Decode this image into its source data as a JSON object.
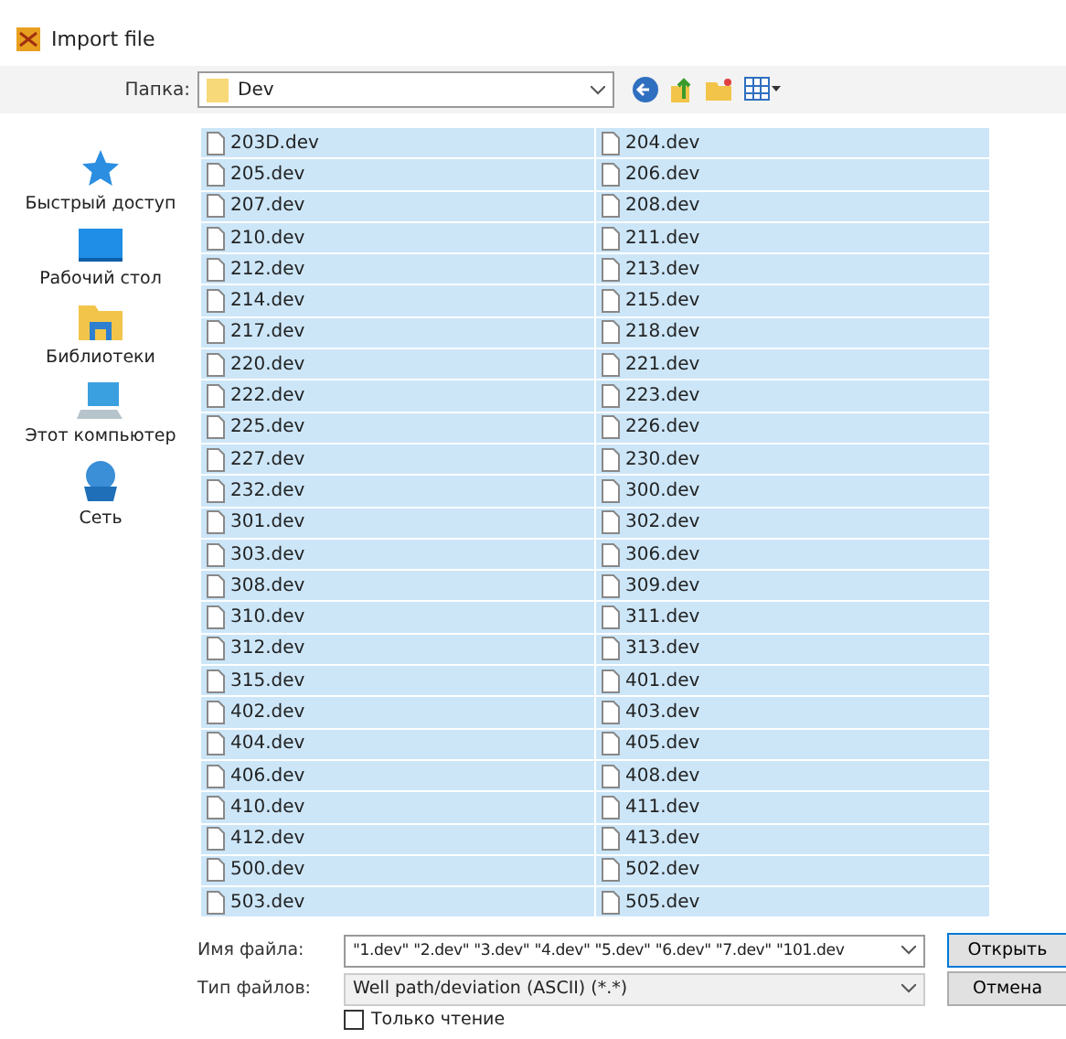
{
  "window": {
    "title": "Import file"
  },
  "look_in": {
    "label": "Папка:",
    "value": "Dev"
  },
  "places": [
    {
      "label": "Быстрый доступ",
      "kind": "star"
    },
    {
      "label": "Рабочий стол",
      "kind": "desktop"
    },
    {
      "label": "Библиотеки",
      "kind": "library"
    },
    {
      "label": "Этот компьютер",
      "kind": "computer"
    },
    {
      "label": "Сеть",
      "kind": "network"
    }
  ],
  "files": [
    {
      "name": "203D.dev",
      "selected": true
    },
    {
      "name": "204.dev",
      "selected": true
    },
    {
      "name": "205.dev",
      "selected": true
    },
    {
      "name": "206.dev",
      "selected": true
    },
    {
      "name": "207.dev",
      "selected": true
    },
    {
      "name": "208.dev",
      "selected": true
    },
    {
      "name": "210.dev",
      "selected": true
    },
    {
      "name": "211.dev",
      "selected": true
    },
    {
      "name": "212.dev",
      "selected": true
    },
    {
      "name": "213.dev",
      "selected": true
    },
    {
      "name": "214.dev",
      "selected": true
    },
    {
      "name": "215.dev",
      "selected": true
    },
    {
      "name": "217.dev",
      "selected": true
    },
    {
      "name": "218.dev",
      "selected": true
    },
    {
      "name": "220.dev",
      "selected": true
    },
    {
      "name": "221.dev",
      "selected": true
    },
    {
      "name": "222.dev",
      "selected": true
    },
    {
      "name": "223.dev",
      "selected": true
    },
    {
      "name": "225.dev",
      "selected": true
    },
    {
      "name": "226.dev",
      "selected": true
    },
    {
      "name": "227.dev",
      "selected": true
    },
    {
      "name": "230.dev",
      "selected": true
    },
    {
      "name": "232.dev",
      "selected": true
    },
    {
      "name": "300.dev",
      "selected": true
    },
    {
      "name": "301.dev",
      "selected": true
    },
    {
      "name": "302.dev",
      "selected": true
    },
    {
      "name": "303.dev",
      "selected": true
    },
    {
      "name": "306.dev",
      "selected": true
    },
    {
      "name": "308.dev",
      "selected": true
    },
    {
      "name": "309.dev",
      "selected": true
    },
    {
      "name": "310.dev",
      "selected": true
    },
    {
      "name": "311.dev",
      "selected": true
    },
    {
      "name": "312.dev",
      "selected": true
    },
    {
      "name": "313.dev",
      "selected": true
    },
    {
      "name": "315.dev",
      "selected": true
    },
    {
      "name": "401.dev",
      "selected": true
    },
    {
      "name": "402.dev",
      "selected": true
    },
    {
      "name": "403.dev",
      "selected": true
    },
    {
      "name": "404.dev",
      "selected": true
    },
    {
      "name": "405.dev",
      "selected": true
    },
    {
      "name": "406.dev",
      "selected": true
    },
    {
      "name": "408.dev",
      "selected": true
    },
    {
      "name": "410.dev",
      "selected": true
    },
    {
      "name": "411.dev",
      "selected": true
    },
    {
      "name": "412.dev",
      "selected": true
    },
    {
      "name": "413.dev",
      "selected": true
    },
    {
      "name": "500.dev",
      "selected": true
    },
    {
      "name": "502.dev",
      "selected": true
    },
    {
      "name": "503.dev",
      "selected": true
    },
    {
      "name": "505.dev",
      "selected": true
    }
  ],
  "file_name": {
    "label": "Имя файла:",
    "value": "\"1.dev\" \"2.dev\" \"3.dev\" \"4.dev\" \"5.dev\" \"6.dev\" \"7.dev\" \"101.dev"
  },
  "file_type": {
    "label": "Тип файлов:",
    "value": "Well path/deviation (ASCII) (*.*)"
  },
  "read_only": {
    "label": "Только чтение",
    "checked": false
  },
  "buttons": [
    "Открыть",
    "Отмена"
  ]
}
